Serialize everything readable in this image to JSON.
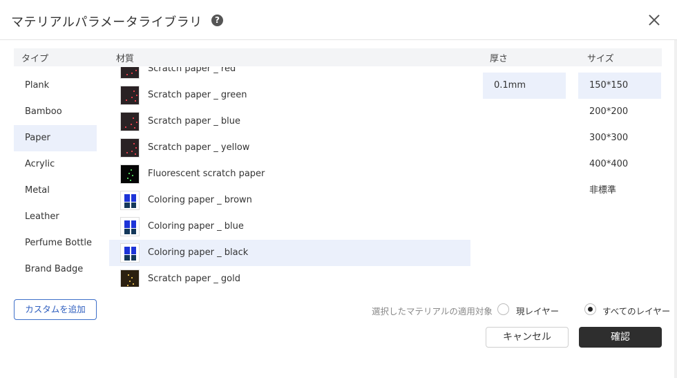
{
  "dialog": {
    "title": "マテリアルパラメータライブラリ",
    "help_glyph": "?"
  },
  "columns": {
    "type": "タイプ",
    "material": "材質",
    "thickness": "厚さ",
    "size": "サイズ"
  },
  "types": [
    {
      "label": "Plank",
      "selected": false
    },
    {
      "label": "Bamboo",
      "selected": false
    },
    {
      "label": "Paper",
      "selected": true
    },
    {
      "label": "Acrylic",
      "selected": false
    },
    {
      "label": "Metal",
      "selected": false
    },
    {
      "label": "Leather",
      "selected": false
    },
    {
      "label": "Perfume Bottle",
      "selected": false
    },
    {
      "label": "Brand Badge",
      "selected": false
    }
  ],
  "materials": [
    {
      "label": "Scratch paper _ red",
      "thumb": "scratch",
      "selected": false
    },
    {
      "label": "Scratch paper _ green",
      "thumb": "scratch",
      "selected": false
    },
    {
      "label": "Scratch paper _ blue",
      "thumb": "scratch",
      "selected": false
    },
    {
      "label": "Scratch paper _ yellow",
      "thumb": "scratch",
      "selected": false
    },
    {
      "label": "Fluorescent scratch paper",
      "thumb": "fluorescent",
      "selected": false
    },
    {
      "label": "Coloring paper _ brown",
      "thumb": "coloring",
      "selected": false
    },
    {
      "label": "Coloring paper _ blue",
      "thumb": "coloring",
      "selected": false
    },
    {
      "label": "Coloring paper _ black",
      "thumb": "coloring",
      "selected": true
    },
    {
      "label": "Scratch paper _ gold",
      "thumb": "gold",
      "selected": false
    }
  ],
  "thickness": [
    "0.1mm"
  ],
  "sizes": [
    {
      "label": "150*150",
      "selected": true
    },
    {
      "label": "200*200",
      "selected": false
    },
    {
      "label": "300*300",
      "selected": false
    },
    {
      "label": "400*400",
      "selected": false
    },
    {
      "label": "非標準",
      "selected": false
    }
  ],
  "footer": {
    "custom_button": "カスタムを追加",
    "apply_label": "選択したマテリアルの適用対象",
    "option_current_layer": "現レイヤー",
    "option_all_layers": "すべてのレイヤー",
    "selected_option": "all",
    "cancel": "キャンセル",
    "confirm": "確認"
  },
  "colors": {
    "selection_bg": "#ebf0fb",
    "accent": "#3d6fc9",
    "confirm_bg": "#2e2e2e"
  }
}
